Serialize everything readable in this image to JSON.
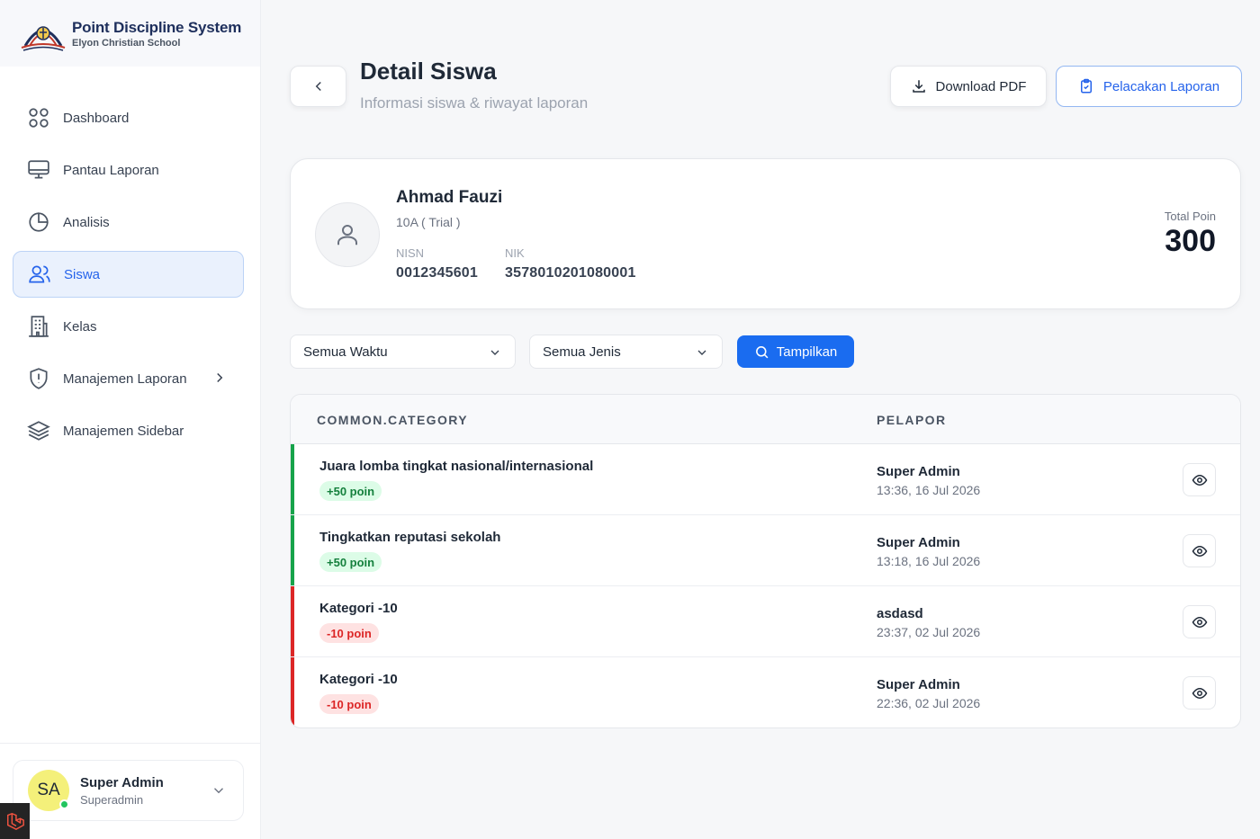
{
  "brand": {
    "title": "Point Discipline System",
    "subtitle": "Elyon Christian School"
  },
  "sidebar": {
    "items": [
      {
        "label": "Dashboard",
        "icon": "dashboard-icon"
      },
      {
        "label": "Pantau Laporan",
        "icon": "monitor-icon"
      },
      {
        "label": "Analisis",
        "icon": "pie-chart-icon"
      },
      {
        "label": "Siswa",
        "icon": "users-icon",
        "active": true
      },
      {
        "label": "Kelas",
        "icon": "building-icon"
      },
      {
        "label": "Manajemen Laporan",
        "icon": "shield-alert-icon",
        "has_submenu": true
      },
      {
        "label": "Manajemen Sidebar",
        "icon": "layers-icon"
      }
    ]
  },
  "user": {
    "initials": "SA",
    "name": "Super Admin",
    "role": "Superadmin",
    "status_color": "#22c55e"
  },
  "header": {
    "title": "Detail Siswa",
    "subtitle": "Informasi siswa & riwayat laporan",
    "download_label": "Download PDF",
    "track_label": "Pelacakan Laporan"
  },
  "student": {
    "name": "Ahmad Fauzi",
    "class": "10A ( Trial )",
    "nisn_label": "NISN",
    "nisn": "0012345601",
    "nik_label": "NIK",
    "nik": "3578010201080001",
    "total_label": "Total Poin",
    "total": "300"
  },
  "filters": {
    "time": "Semua Waktu",
    "type": "Semua Jenis",
    "show_label": "Tampilkan"
  },
  "table": {
    "headers": {
      "category": "COMMON.CATEGORY",
      "reporter": "PELAPOR"
    },
    "rows": [
      {
        "category": "Juara lomba tingkat nasional/internasional",
        "points": "+50 poin",
        "reporter": "Super Admin",
        "time": "13:36, 16 Jul 2026",
        "type": "positive"
      },
      {
        "category": "Tingkatkan reputasi sekolah",
        "points": "+50 poin",
        "reporter": "Super Admin",
        "time": "13:18, 16 Jul 2026",
        "type": "positive"
      },
      {
        "category": "Kategori -10",
        "points": "-10 poin",
        "reporter": "asdasd",
        "time": "23:37, 02 Jul 2026",
        "type": "negative"
      },
      {
        "category": "Kategori -10",
        "points": "-10 poin",
        "reporter": "Super Admin",
        "time": "22:36, 02 Jul 2026",
        "type": "negative"
      }
    ]
  },
  "colors": {
    "accent": "#2563eb",
    "primary_button": "#1a6cf0",
    "positive": "#16a34a",
    "negative": "#dc2626",
    "avatar_bg": "#f4f07a"
  }
}
